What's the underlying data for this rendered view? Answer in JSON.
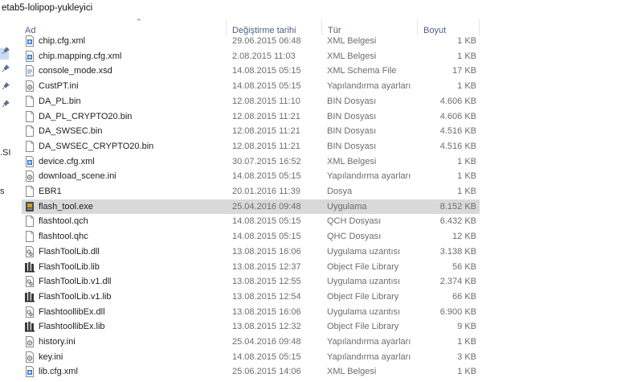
{
  "window": {
    "title": "etab5-lolipop-yukleyici"
  },
  "side": {
    "frag_si": ".SI",
    "frag_s": "s"
  },
  "columns": {
    "name": "Ad",
    "date": "Değiştirme tarihi",
    "type": "Tür",
    "size": "Boyut"
  },
  "files": [
    {
      "name": "chip.cfg.xml",
      "date": "29.06.2015 06:48",
      "type": "XML Belgesi",
      "size": "1 KB",
      "icon": "xml-document-icon",
      "selected": false
    },
    {
      "name": "chip.mapping.cfg.xml",
      "date": "2.08.2015 11:03",
      "type": "XML Belgesi",
      "size": "1 KB",
      "icon": "xml-document-icon",
      "selected": false
    },
    {
      "name": "console_mode.xsd",
      "date": "14.08.2015 05:15",
      "type": "XML Schema File",
      "size": "17 KB",
      "icon": "xsd-file-icon",
      "selected": false
    },
    {
      "name": "CustPT.ini",
      "date": "14.08.2015 05:15",
      "type": "Yapılandırma ayarları",
      "size": "1 KB",
      "icon": "settings-file-icon",
      "selected": false
    },
    {
      "name": "DA_PL.bin",
      "date": "12.08.2015 11:10",
      "type": "BIN Dosyası",
      "size": "4.606 KB",
      "icon": "blank-file-icon",
      "selected": false
    },
    {
      "name": "DA_PL_CRYPTO20.bin",
      "date": "12.08.2015 11:21",
      "type": "BIN Dosyası",
      "size": "4.606 KB",
      "icon": "blank-file-icon",
      "selected": false
    },
    {
      "name": "DA_SWSEC.bin",
      "date": "12.08.2015 11:21",
      "type": "BIN Dosyası",
      "size": "4.516 KB",
      "icon": "blank-file-icon",
      "selected": false
    },
    {
      "name": "DA_SWSEC_CRYPTO20.bin",
      "date": "12.08.2015 11:21",
      "type": "BIN Dosyası",
      "size": "4.516 KB",
      "icon": "blank-file-icon",
      "selected": false
    },
    {
      "name": "device.cfg.xml",
      "date": "30.07.2015 16:52",
      "type": "XML Belgesi",
      "size": "1 KB",
      "icon": "xml-document-icon",
      "selected": false
    },
    {
      "name": "download_scene.ini",
      "date": "14.08.2015 05:15",
      "type": "Yapılandırma ayarları",
      "size": "1 KB",
      "icon": "settings-file-icon",
      "selected": false
    },
    {
      "name": "EBR1",
      "date": "20.01.2016 11:39",
      "type": "Dosya",
      "size": "1 KB",
      "icon": "blank-file-icon",
      "selected": false
    },
    {
      "name": "flash_tool.exe",
      "date": "25.04.2016 09:48",
      "type": "Uygulama",
      "size": "8.152 KB",
      "icon": "application-icon",
      "selected": true
    },
    {
      "name": "flashtool.qch",
      "date": "14.08.2015 05:15",
      "type": "QCH Dosyası",
      "size": "6.432 KB",
      "icon": "blank-file-icon",
      "selected": false
    },
    {
      "name": "flashtool.qhc",
      "date": "14.08.2015 05:15",
      "type": "QHC Dosyası",
      "size": "12 KB",
      "icon": "blank-file-icon",
      "selected": false
    },
    {
      "name": "FlashToolLib.dll",
      "date": "13.08.2015 16:06",
      "type": "Uygulama uzantısı",
      "size": "3.138 KB",
      "icon": "dll-file-icon",
      "selected": false
    },
    {
      "name": "FlashToolLib.lib",
      "date": "13.08.2015 12:37",
      "type": "Object File Library",
      "size": "56 KB",
      "icon": "library-icon",
      "selected": false
    },
    {
      "name": "FlashToolLib.v1.dll",
      "date": "13.08.2015 12:55",
      "type": "Uygulama uzantısı",
      "size": "2.374 KB",
      "icon": "dll-file-icon",
      "selected": false
    },
    {
      "name": "FlashToolLib.v1.lib",
      "date": "13.08.2015 12:54",
      "type": "Object File Library",
      "size": "66 KB",
      "icon": "library-icon",
      "selected": false
    },
    {
      "name": "FlashtoollibEx.dll",
      "date": "13.08.2015 16:06",
      "type": "Uygulama uzantısı",
      "size": "6.900 KB",
      "icon": "dll-file-icon",
      "selected": false
    },
    {
      "name": "FlashtoollibEx.lib",
      "date": "13.08.2015 12:32",
      "type": "Object File Library",
      "size": "9 KB",
      "icon": "library-icon",
      "selected": false
    },
    {
      "name": "history.ini",
      "date": "25.04.2016 09:48",
      "type": "Yapılandırma ayarları",
      "size": "1 KB",
      "icon": "settings-file-icon",
      "selected": false
    },
    {
      "name": "key.ini",
      "date": "14.08.2015 05:15",
      "type": "Yapılandırma ayarları",
      "size": "3 KB",
      "icon": "settings-file-icon",
      "selected": false
    },
    {
      "name": "lib.cfg.xml",
      "date": "25.06.2015 14:06",
      "type": "XML Belgesi",
      "size": "1 KB",
      "icon": "xml-document-icon",
      "selected": false
    }
  ]
}
